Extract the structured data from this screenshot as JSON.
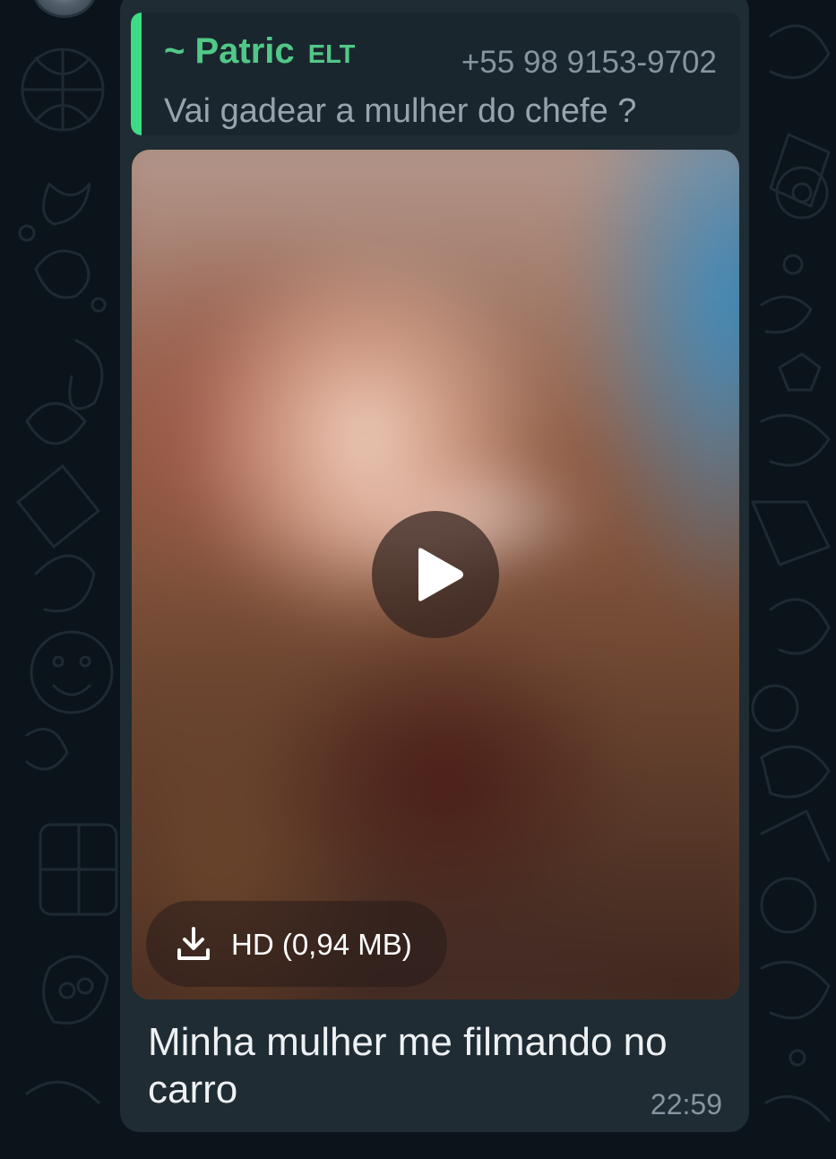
{
  "chat": {
    "quoted_message": {
      "sender_name": "~ Patric",
      "sender_tag": "ELT",
      "sender_phone": "+55 98 9153-9702",
      "text": "Vai gadear a mulher do chefe ?",
      "accent_color": "#3ddc84"
    },
    "media": {
      "type": "video",
      "play_icon": "play-icon",
      "download_icon": "download-icon",
      "download_label": "HD (0,94 MB)"
    },
    "caption": "Minha mulher me filmando no carro",
    "time": "22:59"
  },
  "colors": {
    "background": "#0b141a",
    "bubble": "#1f2c34",
    "quote_bg": "#1a262e",
    "sender_name": "#51c887",
    "secondary_text": "#8696a0",
    "primary_text": "#eef1f3"
  }
}
